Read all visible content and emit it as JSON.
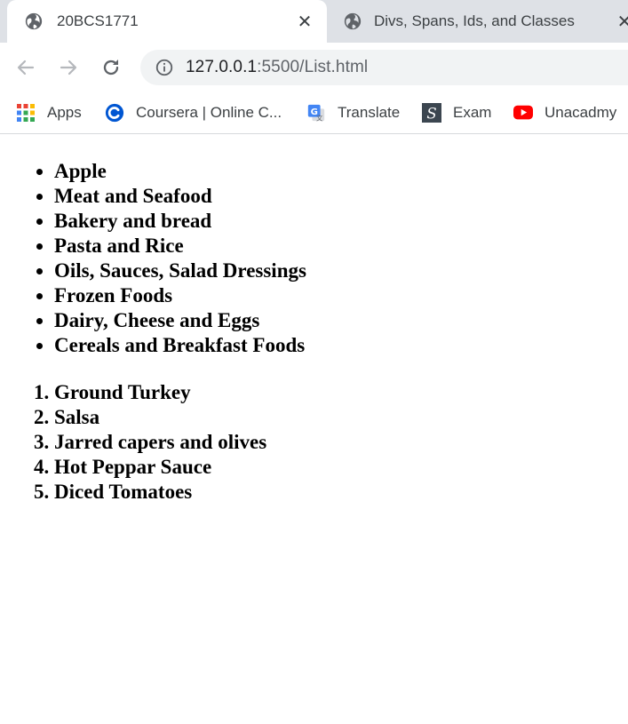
{
  "tabs": [
    {
      "title": "20BCS1771",
      "active": true
    },
    {
      "title": "Divs, Spans, Ids, and Classes",
      "active": false
    }
  ],
  "toolbar": {
    "url_host": "127.0.0.1",
    "url_rest": ":5500/List.html"
  },
  "bookmarks": [
    {
      "label": "Apps",
      "icon": "apps-grid-icon"
    },
    {
      "label": "Coursera | Online C...",
      "icon": "coursera-icon"
    },
    {
      "label": "Translate",
      "icon": "google-translate-icon"
    },
    {
      "label": "Exam",
      "icon": "exam-icon"
    },
    {
      "label": "Unacadmy",
      "icon": "youtube-icon"
    }
  ],
  "content": {
    "unordered": [
      "Apple",
      "Meat and Seafood",
      "Bakery and bread",
      "Pasta and Rice",
      "Oils, Sauces, Salad Dressings",
      "Frozen Foods",
      "Dairy, Cheese and Eggs",
      "Cereals and Breakfast Foods"
    ],
    "ordered": [
      "Ground Turkey",
      "Salsa",
      "Jarred capers and olives",
      "Hot Peppar Sauce",
      "Diced Tomatoes"
    ]
  }
}
